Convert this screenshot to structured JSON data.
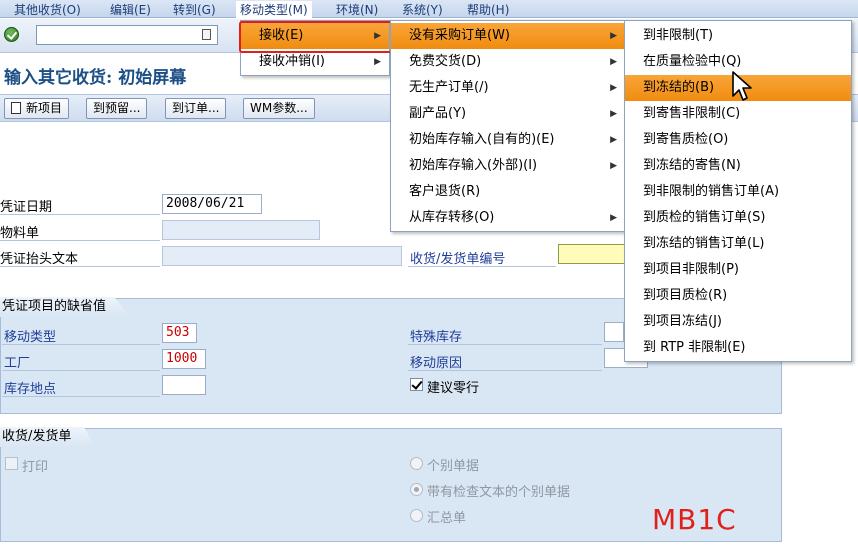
{
  "menubar": {
    "items": [
      "其他收货(O)",
      "编辑(E)",
      "转到(G)",
      "移动类型(M)",
      "环境(N)",
      "系统(Y)",
      "帮助(H)"
    ]
  },
  "title": "输入其它收货: 初始屏幕",
  "app_toolbar": {
    "new_item": "新项目",
    "to_reservation": "到预留...",
    "to_order": "到订单...",
    "wm_params": "WM参数..."
  },
  "header_fields": {
    "doc_date_label": "凭证日期",
    "doc_date_value": "2008/06/21",
    "material_slip_label": "物料单",
    "header_text_label": "凭证抬头文本",
    "delivery_note_label": "收货/发货单编号"
  },
  "defaults_group": {
    "title": "凭证项目的缺省值",
    "movement_type_label": "移动类型",
    "movement_type_value": "503",
    "plant_label": "工厂",
    "plant_value": "1000",
    "storage_location_label": "库存地点",
    "special_stock_label": "特殊库存",
    "movement_reason_label": "移动原因",
    "suggest_zero_lines_label": "建议零行"
  },
  "gr_slip_group": {
    "title": "收货/发货单",
    "print_label": "打印",
    "radio_individual": "个别单据",
    "radio_individual_inspection": "带有检查文本的个别单据",
    "radio_collective": "汇总单"
  },
  "menu_level1": [
    "接收(E)",
    "接收冲销(I)"
  ],
  "menu_level2": [
    "没有采购订单(W)",
    "免费交货(D)",
    "无生产订单(/)",
    "副产品(Y)",
    "初始库存输入(自有的)(E)",
    "初始库存输入(外部)(I)",
    "客户退货(R)",
    "从库存转移(O)"
  ],
  "menu_level3": [
    "到非限制(T)",
    "在质量检验中(Q)",
    "到冻结的(B)",
    "到寄售非限制(C)",
    "到寄售质检(O)",
    "到冻结的寄售(N)",
    "到非限制的销售订单(A)",
    "到质检的销售订单(S)",
    "到冻结的销售订单(L)",
    "到项目非限制(P)",
    "到项目质检(R)",
    "到项目冻结(J)",
    "到 RTP 非限制(E)"
  ],
  "annotation": "MB1C",
  "colors": {
    "highlight": "#f29515",
    "annotation_red": "#e0201b",
    "required_red": "#cc0000",
    "label_blue": "#1f3f9a"
  }
}
